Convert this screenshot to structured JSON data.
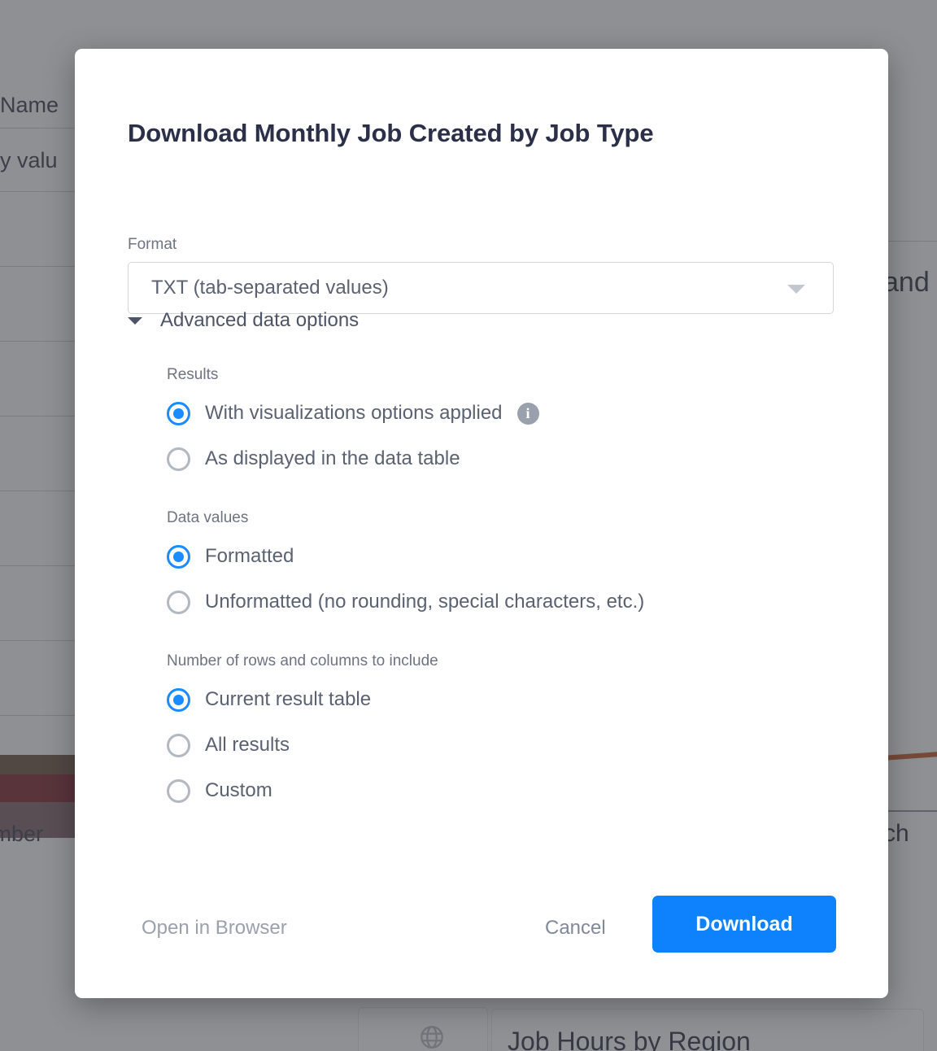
{
  "background": {
    "table_header": "nt Name",
    "filter_row": "any valu",
    "row_label": "ecember",
    "right_fragment_1": "and",
    "right_fragment_2": "ch",
    "globe_icon": "globe-icon",
    "card_title": "Job Hours by Region",
    "bar_colors": [
      "#6b5544",
      "#7e2830",
      "#7d6369"
    ],
    "chart_line_color": "#c25a2a"
  },
  "modal": {
    "title": "Download Monthly Job Created by Job Type",
    "format": {
      "label": "Format",
      "selected": "TXT (tab-separated values)",
      "caret_icon": "chevron-down-icon"
    },
    "advanced": {
      "caret_icon": "caret-down-icon",
      "title": "Advanced data options",
      "groups": [
        {
          "label": "Results",
          "options": [
            {
              "label": "With visualizations options applied",
              "selected": true,
              "info_icon": "info-icon"
            },
            {
              "label": "As displayed in the data table",
              "selected": false
            }
          ]
        },
        {
          "label": "Data values",
          "options": [
            {
              "label": "Formatted",
              "selected": true
            },
            {
              "label": "Unformatted (no rounding, special characters, etc.)",
              "selected": false
            }
          ]
        },
        {
          "label": "Number of rows and columns to include",
          "options": [
            {
              "label": "Current result table",
              "selected": true
            },
            {
              "label": "All results",
              "selected": false
            },
            {
              "label": "Custom",
              "selected": false
            }
          ]
        }
      ]
    },
    "footer": {
      "open_in_browser": "Open in Browser",
      "cancel": "Cancel",
      "download": "Download"
    }
  },
  "colors": {
    "accent": "#0d82fc",
    "radio_on": "#1a8cff",
    "radio_off": "#b2b7c0",
    "title": "#2b3048",
    "label": "#6d7380",
    "body": "#5a6170",
    "info_badge": "#9aa0ac",
    "scrim": "rgba(60,62,68,0.56)"
  }
}
